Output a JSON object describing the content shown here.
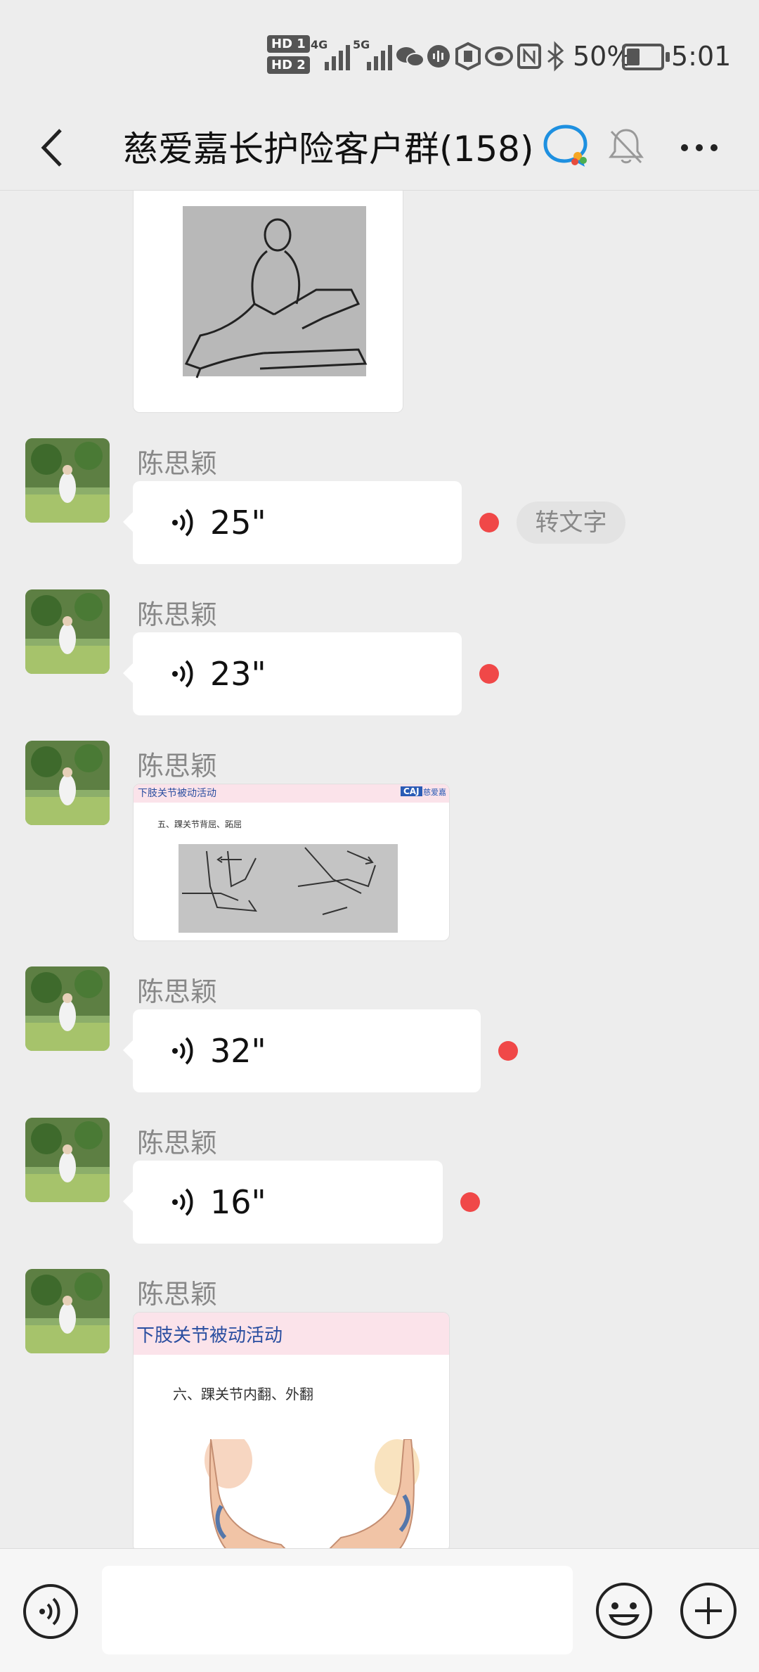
{
  "status_bar": {
    "hd1": "HD 1",
    "hd2": "HD 2",
    "net1": "4G",
    "net2": "5G",
    "battery": "50%",
    "time": "5:01"
  },
  "header": {
    "title": "慈爱嘉长护险客户群(158)"
  },
  "messages": [
    {
      "type": "image",
      "sender": "",
      "description": "sketch of seated person massaging leg"
    },
    {
      "type": "voice",
      "sender": "陈思颖",
      "duration": "25\"",
      "unread": true,
      "action": "转文字"
    },
    {
      "type": "voice",
      "sender": "陈思颖",
      "duration": "23\"",
      "unread": true
    },
    {
      "type": "image",
      "sender": "陈思颖",
      "slide": {
        "header": "下肢关节被动活动",
        "badge": "CAJ",
        "brand": "慈爱嘉",
        "subtitle": "五、踝关节背屈、跖屈"
      }
    },
    {
      "type": "voice",
      "sender": "陈思颖",
      "duration": "32\"",
      "unread": true
    },
    {
      "type": "voice",
      "sender": "陈思颖",
      "duration": "16\"",
      "unread": true
    },
    {
      "type": "image",
      "sender": "陈思颖",
      "slide": {
        "header": "下肢关节被动活动",
        "subtitle": "六、踝关节内翻、外翻"
      }
    }
  ],
  "input_bar": {
    "voice_icon": "voice-icon",
    "emoji_icon": "emoji-icon",
    "plus_icon": "plus-icon"
  }
}
